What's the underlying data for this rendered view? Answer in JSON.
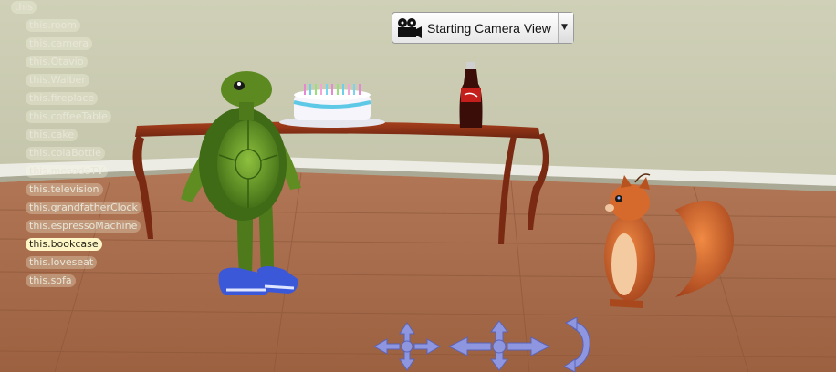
{
  "scene_tree": {
    "root": "this",
    "items": [
      "this.room",
      "this.camera",
      "this.Otavio",
      "this.Walber",
      "this.fireplace",
      "this.coffeeTable",
      "this.cake",
      "this.colaBottle",
      "this.mesadaTV",
      "this.television",
      "this.grandfatherClock",
      "this.espressoMachine",
      "this.bookcase",
      "this.loveseat",
      "this.sofa"
    ],
    "selected": "this.bookcase"
  },
  "camera_view": {
    "label": "Starting Camera View",
    "icon": "movie-camera-icon"
  },
  "controls": {
    "move_icon": "four-way-move-arrows-icon",
    "turn_icon": "turn-arrows-icon",
    "rotate_icon": "rotate-arrow-icon"
  },
  "colors": {
    "wall": "#c8c9b0",
    "floor": "#a56a48",
    "control_blue": "#8e96e0",
    "selected_node": "#fff6c8"
  }
}
